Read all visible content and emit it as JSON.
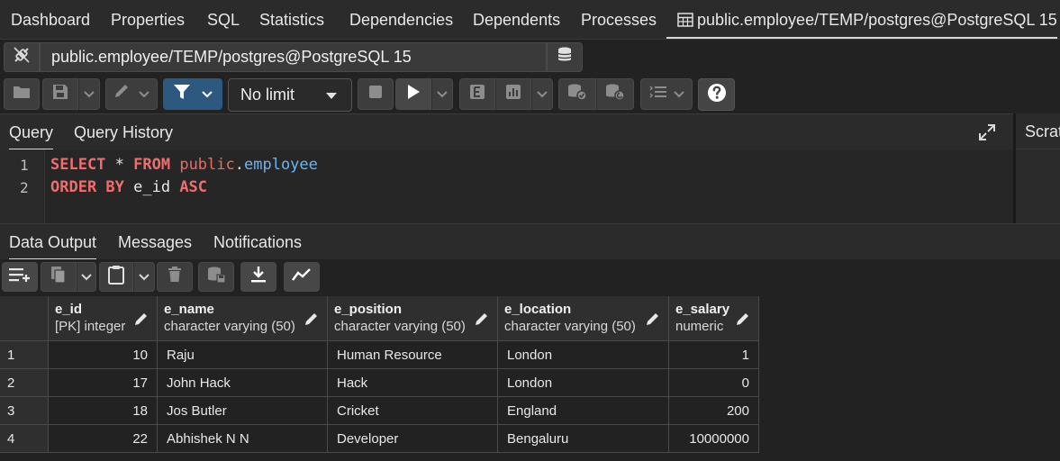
{
  "top_tabs": [
    "Dashboard",
    "Properties",
    "SQL",
    "Statistics",
    "Dependencies",
    "Dependents",
    "Processes"
  ],
  "active_tab": "public.employee/TEMP/postgres@PostgreSQL 15",
  "connection": "public.employee/TEMP/postgres@PostgreSQL 15",
  "toolbar": {
    "limit": "No limit"
  },
  "query_tabs": [
    "Query",
    "Query History"
  ],
  "scratch": "Scrat",
  "editor": {
    "line_numbers": [
      "1",
      "2"
    ],
    "line1": {
      "kw1": "SELECT",
      "star": " * ",
      "kw2": "FROM",
      "schema": " public",
      "dot": ".",
      "table": "employee"
    },
    "line2": {
      "kw1": "ORDER BY",
      "col": " e_id ",
      "kw2": "ASC"
    }
  },
  "result_tabs": [
    "Data Output",
    "Messages",
    "Notifications"
  ],
  "grid": {
    "columns": [
      {
        "name": "e_id",
        "type": "[PK] integer"
      },
      {
        "name": "e_name",
        "type": "character varying (50)"
      },
      {
        "name": "e_position",
        "type": "character varying (50)"
      },
      {
        "name": "e_location",
        "type": "character varying (50)"
      },
      {
        "name": "e_salary",
        "type": "numeric"
      }
    ],
    "rows": [
      {
        "n": "1",
        "e_id": "10",
        "e_name": "Raju",
        "e_position": "Human Resource",
        "e_location": "London",
        "e_salary": "1"
      },
      {
        "n": "2",
        "e_id": "17",
        "e_name": "John Hack",
        "e_position": "Hack",
        "e_location": "London",
        "e_salary": "0"
      },
      {
        "n": "3",
        "e_id": "18",
        "e_name": "Jos Butler",
        "e_position": "Cricket",
        "e_location": "England",
        "e_salary": "200"
      },
      {
        "n": "4",
        "e_id": "22",
        "e_name": "Abhishek N N",
        "e_position": "Developer",
        "e_location": "Bengaluru",
        "e_salary": "10000000"
      }
    ]
  },
  "icons": {
    "connection": "connection-status-icon",
    "database": "database-icon",
    "open": "folder-icon",
    "save": "save-icon",
    "edit": "pencil-icon",
    "filter": "filter-icon",
    "stop": "stop-icon",
    "execute": "play-icon",
    "explain": "explain-icon",
    "explain_analyze": "chart-icon",
    "commit": "commit-icon",
    "rollback": "rollback-icon",
    "macros": "list-icon",
    "help": "help-icon",
    "expand": "expand-icon",
    "add_row": "add-row-icon",
    "copy": "copy-icon",
    "paste": "paste-icon",
    "delete": "trash-icon",
    "save_data": "save-data-icon",
    "download": "download-icon",
    "graph": "graph-icon"
  },
  "colors": {
    "filter_active": "#2d5980",
    "keyword": "#f16d6d",
    "property": "#6fb4ee"
  }
}
